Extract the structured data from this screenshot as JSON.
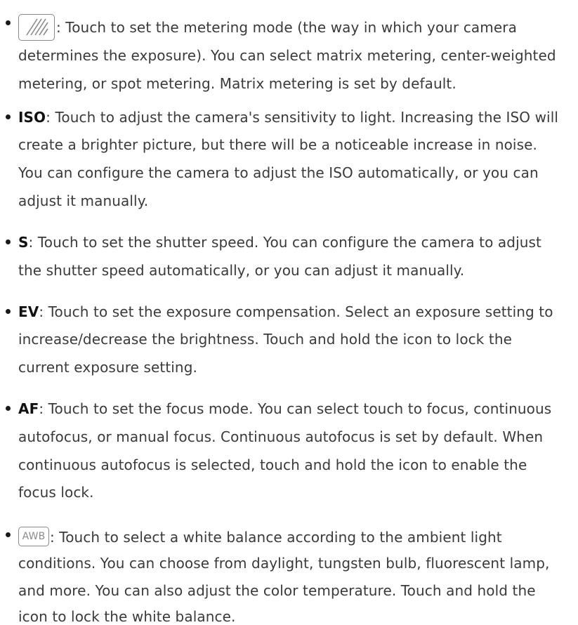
{
  "items": [
    {
      "icon": "metering-mode-icon",
      "lines": [
        ": Touch to set the metering mode (the way in which your camera",
        "determines the exposure). You can select matrix metering, center-weighted",
        "metering, or spot metering. Matrix metering is set by default."
      ]
    },
    {
      "term": "ISO",
      "lines": [
        ": Touch to adjust the camera's sensitivity to light. Increasing the ISO will",
        "create a brighter picture, but there will be a noticeable increase in noise.",
        "You can configure the camera to adjust the ISO automatically, or you can",
        "adjust it manually."
      ]
    },
    {
      "term": "S",
      "lines": [
        ": Touch to set the shutter speed. You can configure the camera to adjust",
        "the shutter speed automatically, or you can adjust it manually."
      ]
    },
    {
      "term": "EV",
      "lines": [
        ": Touch to set the exposure compensation. Select an exposure setting to",
        "increase/decrease the brightness. Touch and hold the icon to lock the",
        "current exposure setting."
      ]
    },
    {
      "term": "AF",
      "lines": [
        ": Touch to set the focus mode. You can select touch to focus, continuous",
        "autofocus, or manual focus. Continuous autofocus is set by default. When",
        "continuous autofocus is selected, touch and hold the icon to enable the",
        "focus lock."
      ]
    },
    {
      "icon": "awb-icon",
      "icon_text": "AWB",
      "lines": [
        ": Touch to select a white balance according to the ambient light",
        "conditions. You can choose from daylight, tungsten bulb, fluorescent lamp,",
        "and more. You can also adjust the color temperature. Touch and hold the",
        "icon to lock the white balance."
      ]
    }
  ]
}
